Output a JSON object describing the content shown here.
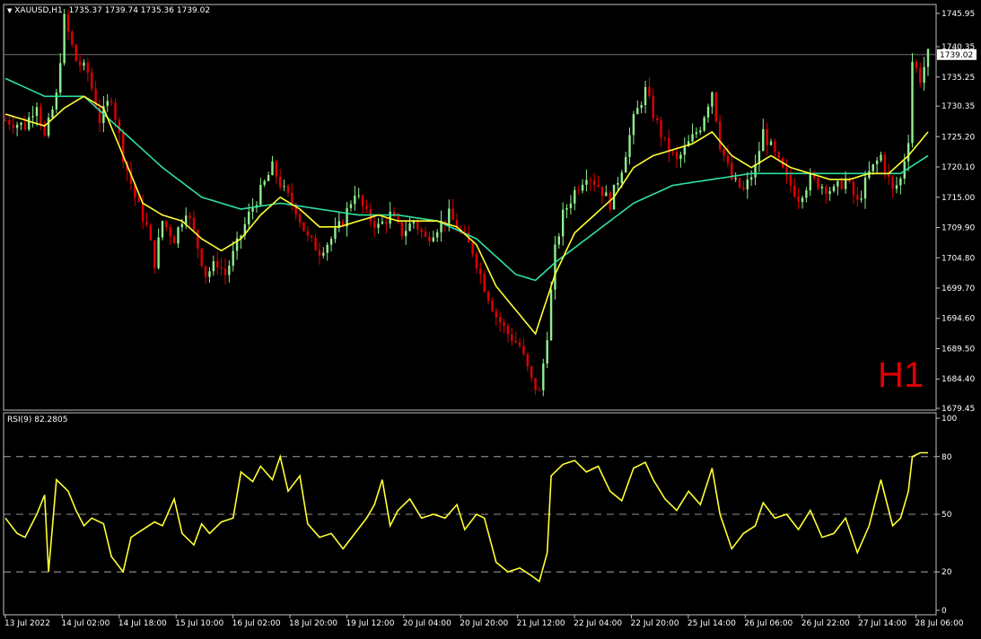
{
  "header": {
    "symbol": "XAUUSD,H1",
    "ohlc": "1735.37 1739.74 1735.36 1739.02"
  },
  "timeframe_label": "H1",
  "colors": {
    "background": "#000000",
    "bull_candle": "#90ee90",
    "bear_candle": "#e00000",
    "fast_ma": "#ffff33",
    "slow_ma": "#2ee0a0",
    "rsi_line": "#ffff33",
    "grid": "#c0c0c0",
    "timeframe_label": "#e00000"
  },
  "chart_data": [
    {
      "type": "candlestick",
      "symbol": "XAUUSD",
      "timeframe": "H1",
      "ylim": [
        1679.45,
        1747.0
      ],
      "y_ticks": [
        "1745.95",
        "1740.35",
        "1735.25",
        "1730.35",
        "1725.20",
        "1720.10",
        "1715.00",
        "1709.90",
        "1704.80",
        "1699.70",
        "1694.60",
        "1689.50",
        "1684.40",
        "1679.45"
      ],
      "current_price": "1739.02",
      "x_ticks": [
        "13 Jul 2022",
        "14 Jul 02:00",
        "14 Jul 18:00",
        "15 Jul 10:00",
        "16 Jul 02:00",
        "18 Jul 20:00",
        "19 Jul 12:00",
        "20 Jul 04:00",
        "20 Jul 20:00",
        "21 Jul 12:00",
        "22 Jul 04:00",
        "22 Jul 20:00",
        "25 Jul 14:00",
        "26 Jul 06:00",
        "26 Jul 22:00",
        "27 Jul 14:00",
        "28 Jul 06:00"
      ],
      "price_path": [
        [
          0,
          1728
        ],
        [
          5,
          1727
        ],
        [
          8,
          1731
        ],
        [
          10,
          1725
        ],
        [
          13,
          1732
        ],
        [
          15,
          1745
        ],
        [
          18,
          1738
        ],
        [
          21,
          1736
        ],
        [
          24,
          1728
        ],
        [
          27,
          1732
        ],
        [
          30,
          1722
        ],
        [
          33,
          1715
        ],
        [
          36,
          1710
        ],
        [
          38,
          1704
        ],
        [
          40,
          1711
        ],
        [
          43,
          1708
        ],
        [
          46,
          1713
        ],
        [
          48,
          1709
        ],
        [
          51,
          1702
        ],
        [
          54,
          1704
        ],
        [
          56,
          1702
        ],
        [
          59,
          1707
        ],
        [
          62,
          1712
        ],
        [
          65,
          1716
        ],
        [
          68,
          1720
        ],
        [
          71,
          1716
        ],
        [
          74,
          1713
        ],
        [
          77,
          1708
        ],
        [
          80,
          1706
        ],
        [
          83,
          1708
        ],
        [
          86,
          1711
        ],
        [
          89,
          1716
        ],
        [
          92,
          1712
        ],
        [
          95,
          1710
        ],
        [
          98,
          1712
        ],
        [
          101,
          1709
        ],
        [
          104,
          1711
        ],
        [
          107,
          1708
        ],
        [
          110,
          1710
        ],
        [
          113,
          1712
        ],
        [
          116,
          1709
        ],
        [
          119,
          1706
        ],
        [
          122,
          1700
        ],
        [
          125,
          1695
        ],
        [
          128,
          1692
        ],
        [
          131,
          1690
        ],
        [
          134,
          1684
        ],
        [
          136,
          1682
        ],
        [
          138,
          1692
        ],
        [
          140,
          1706
        ],
        [
          142,
          1712
        ],
        [
          145,
          1716
        ],
        [
          148,
          1719
        ],
        [
          151,
          1717
        ],
        [
          154,
          1714
        ],
        [
          157,
          1720
        ],
        [
          160,
          1728
        ],
        [
          163,
          1733
        ],
        [
          165,
          1729
        ],
        [
          168,
          1724
        ],
        [
          171,
          1721
        ],
        [
          174,
          1724
        ],
        [
          177,
          1727
        ],
        [
          180,
          1733
        ],
        [
          182,
          1724
        ],
        [
          185,
          1718
        ],
        [
          188,
          1716
        ],
        [
          191,
          1720
        ],
        [
          193,
          1726
        ],
        [
          196,
          1722
        ],
        [
          199,
          1718
        ],
        [
          202,
          1715
        ],
        [
          205,
          1718
        ],
        [
          208,
          1717
        ],
        [
          211,
          1716
        ],
        [
          214,
          1718
        ],
        [
          217,
          1714
        ],
        [
          220,
          1719
        ],
        [
          223,
          1722
        ],
        [
          226,
          1716
        ],
        [
          228,
          1718
        ],
        [
          230,
          1725
        ],
        [
          231,
          1738
        ],
        [
          233,
          1735
        ],
        [
          235,
          1739
        ]
      ],
      "ma_fast_path": [
        [
          0,
          1729
        ],
        [
          10,
          1727
        ],
        [
          15,
          1730
        ],
        [
          20,
          1732
        ],
        [
          25,
          1730
        ],
        [
          30,
          1722
        ],
        [
          35,
          1714
        ],
        [
          40,
          1712
        ],
        [
          45,
          1711
        ],
        [
          50,
          1708
        ],
        [
          55,
          1706
        ],
        [
          60,
          1708
        ],
        [
          65,
          1712
        ],
        [
          70,
          1715
        ],
        [
          75,
          1713
        ],
        [
          80,
          1710
        ],
        [
          85,
          1710
        ],
        [
          90,
          1711
        ],
        [
          95,
          1712
        ],
        [
          100,
          1711
        ],
        [
          110,
          1711
        ],
        [
          115,
          1710
        ],
        [
          120,
          1707
        ],
        [
          125,
          1700
        ],
        [
          130,
          1696
        ],
        [
          135,
          1692
        ],
        [
          140,
          1702
        ],
        [
          145,
          1709
        ],
        [
          150,
          1712
        ],
        [
          155,
          1715
        ],
        [
          160,
          1720
        ],
        [
          165,
          1722
        ],
        [
          170,
          1723
        ],
        [
          175,
          1724
        ],
        [
          180,
          1726
        ],
        [
          185,
          1722
        ],
        [
          190,
          1720
        ],
        [
          195,
          1722
        ],
        [
          200,
          1720
        ],
        [
          205,
          1719
        ],
        [
          210,
          1718
        ],
        [
          215,
          1718
        ],
        [
          220,
          1719
        ],
        [
          225,
          1719
        ],
        [
          230,
          1722
        ],
        [
          235,
          1726
        ]
      ],
      "ma_slow_path": [
        [
          0,
          1735
        ],
        [
          10,
          1732
        ],
        [
          20,
          1732
        ],
        [
          30,
          1726
        ],
        [
          40,
          1720
        ],
        [
          50,
          1715
        ],
        [
          60,
          1713
        ],
        [
          70,
          1714
        ],
        [
          80,
          1713
        ],
        [
          90,
          1712
        ],
        [
          100,
          1712
        ],
        [
          110,
          1711
        ],
        [
          120,
          1708
        ],
        [
          130,
          1702
        ],
        [
          135,
          1701
        ],
        [
          140,
          1704
        ],
        [
          150,
          1709
        ],
        [
          160,
          1714
        ],
        [
          170,
          1717
        ],
        [
          180,
          1718
        ],
        [
          190,
          1719
        ],
        [
          200,
          1719
        ],
        [
          210,
          1719
        ],
        [
          220,
          1719
        ],
        [
          228,
          1719
        ],
        [
          235,
          1722
        ]
      ]
    },
    {
      "type": "line",
      "indicator": "RSI(9) 82.2805",
      "ylim": [
        0,
        100
      ],
      "y_ticks": [
        "100",
        "80",
        "50",
        "20",
        "0"
      ],
      "levels": [
        80,
        50,
        20
      ],
      "values": [
        [
          0,
          48
        ],
        [
          3,
          40
        ],
        [
          5,
          38
        ],
        [
          8,
          50
        ],
        [
          10,
          60
        ],
        [
          11,
          20
        ],
        [
          13,
          68
        ],
        [
          16,
          62
        ],
        [
          18,
          52
        ],
        [
          20,
          44
        ],
        [
          22,
          48
        ],
        [
          25,
          45
        ],
        [
          27,
          28
        ],
        [
          30,
          20
        ],
        [
          32,
          38
        ],
        [
          35,
          42
        ],
        [
          38,
          46
        ],
        [
          40,
          44
        ],
        [
          43,
          58
        ],
        [
          45,
          40
        ],
        [
          48,
          34
        ],
        [
          50,
          45
        ],
        [
          52,
          40
        ],
        [
          55,
          46
        ],
        [
          58,
          48
        ],
        [
          60,
          72
        ],
        [
          63,
          67
        ],
        [
          65,
          75
        ],
        [
          68,
          68
        ],
        [
          70,
          80
        ],
        [
          72,
          62
        ],
        [
          75,
          70
        ],
        [
          77,
          45
        ],
        [
          80,
          38
        ],
        [
          83,
          40
        ],
        [
          86,
          32
        ],
        [
          89,
          40
        ],
        [
          92,
          48
        ],
        [
          94,
          55
        ],
        [
          96,
          68
        ],
        [
          98,
          44
        ],
        [
          100,
          52
        ],
        [
          103,
          58
        ],
        [
          106,
          48
        ],
        [
          109,
          50
        ],
        [
          112,
          48
        ],
        [
          115,
          55
        ],
        [
          117,
          42
        ],
        [
          120,
          50
        ],
        [
          122,
          48
        ],
        [
          125,
          25
        ],
        [
          128,
          20
        ],
        [
          131,
          22
        ],
        [
          134,
          18
        ],
        [
          136,
          15
        ],
        [
          138,
          30
        ],
        [
          139,
          70
        ],
        [
          142,
          76
        ],
        [
          145,
          78
        ],
        [
          148,
          72
        ],
        [
          151,
          75
        ],
        [
          154,
          62
        ],
        [
          157,
          57
        ],
        [
          160,
          74
        ],
        [
          163,
          77
        ],
        [
          165,
          68
        ],
        [
          168,
          58
        ],
        [
          171,
          52
        ],
        [
          174,
          62
        ],
        [
          177,
          55
        ],
        [
          180,
          74
        ],
        [
          182,
          50
        ],
        [
          185,
          32
        ],
        [
          188,
          40
        ],
        [
          191,
          44
        ],
        [
          193,
          56
        ],
        [
          196,
          48
        ],
        [
          199,
          50
        ],
        [
          202,
          42
        ],
        [
          205,
          52
        ],
        [
          208,
          38
        ],
        [
          211,
          40
        ],
        [
          214,
          48
        ],
        [
          217,
          30
        ],
        [
          220,
          44
        ],
        [
          223,
          68
        ],
        [
          226,
          44
        ],
        [
          228,
          48
        ],
        [
          230,
          62
        ],
        [
          231,
          80
        ],
        [
          233,
          82
        ],
        [
          235,
          82
        ]
      ]
    }
  ]
}
